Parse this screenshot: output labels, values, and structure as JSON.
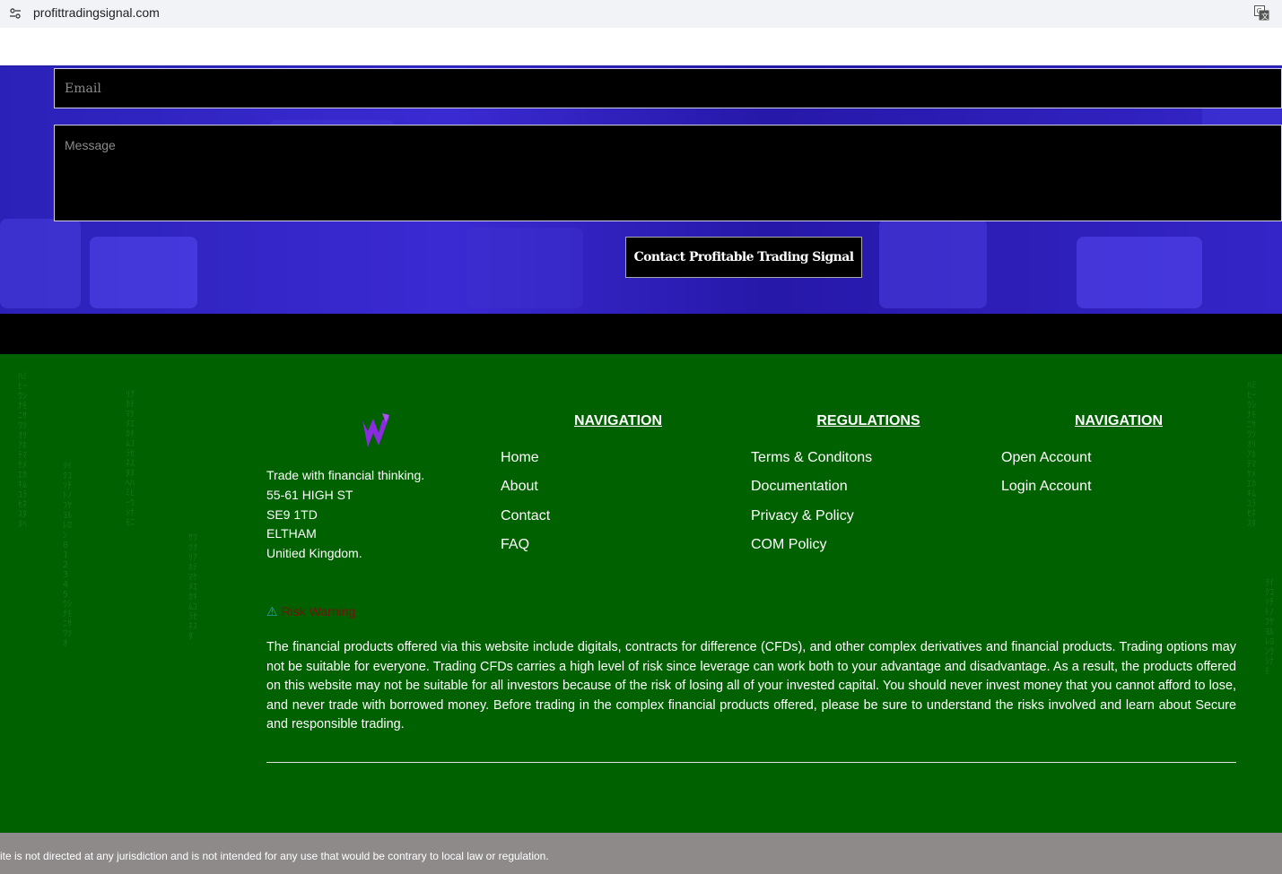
{
  "browser": {
    "url": "profittradingsignal.com",
    "site_icon": "site-settings-icon",
    "translate_icon": "translate-icon"
  },
  "contact_form": {
    "email_placeholder": "Email",
    "message_placeholder": "Message",
    "submit_label": "Contact Profitable Trading Signal"
  },
  "footer": {
    "logo": "logo-icon",
    "address_lines": [
      "Trade with financial thinking.",
      "55-61 HIGH ST",
      "SE9 1TD",
      "ELTHAM",
      "Unitied Kingdom."
    ],
    "columns": [
      {
        "title": "NAVIGATION",
        "links": [
          "Home",
          "About",
          "Contact",
          "FAQ"
        ]
      },
      {
        "title": "REGULATIONS",
        "links": [
          "Terms & Conditons",
          "Documentation",
          "Privacy & Policy",
          "COM Policy"
        ]
      },
      {
        "title": "NAVIGATION",
        "links": [
          "Open Account",
          "Login Account"
        ]
      }
    ],
    "risk_warning_icon": "⚠",
    "risk_warning_label": "Risk Warning",
    "disclaimer": "The financial products offered via this website include digitals, contracts for difference (CFDs), and other complex derivatives and financial products. Trading options may not be suitable for everyone. Trading CFDs carries a high level of risk since leverage can work both to your advantage and disadvantage. As a result, the products offered on this website may not be suitable for all investors because of the risk of losing all of your invested capital. You should never invest money that you cannot afford to lose, and never trade with borrowed money. Before trading in the complex financial products offered, please be sure to understand the risks involved and learn about Secure and responsible trading.",
    "bottom_notice": "ite is not directed at any jurisdiction and is not intended for any use that would be contrary to local law or regulation."
  },
  "colors": {
    "footer_bg": "#006100",
    "contact_bg": "#2b21b8",
    "risk_text": "#7a1010",
    "bottom_bar": "#8e8a8a"
  }
}
